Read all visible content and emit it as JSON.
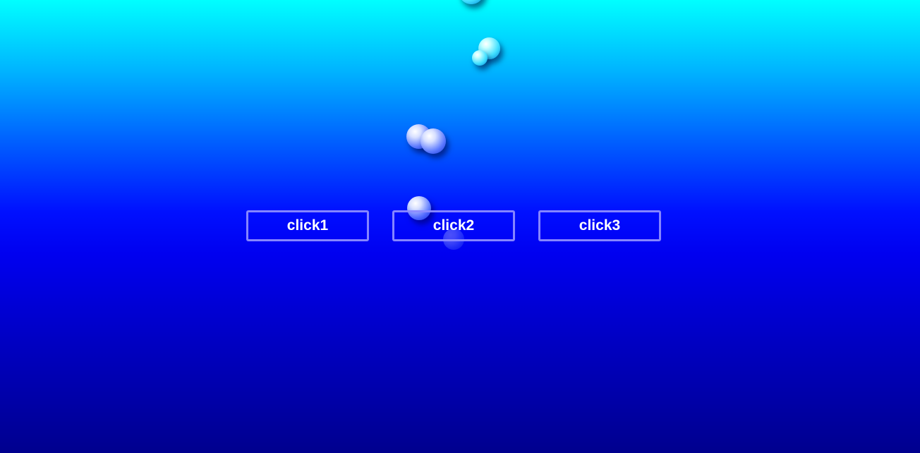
{
  "buttons": [
    {
      "label": "click1"
    },
    {
      "label": "click2"
    },
    {
      "label": "click3"
    }
  ],
  "colors": {
    "gradient_top": "#00ffff",
    "gradient_middle": "#0010ff",
    "gradient_bottom": "#00008e",
    "button_border": "#8c8cff",
    "button_text": "#ffffff"
  },
  "decorations": {
    "bubbles_icon": "bubble-sphere"
  }
}
